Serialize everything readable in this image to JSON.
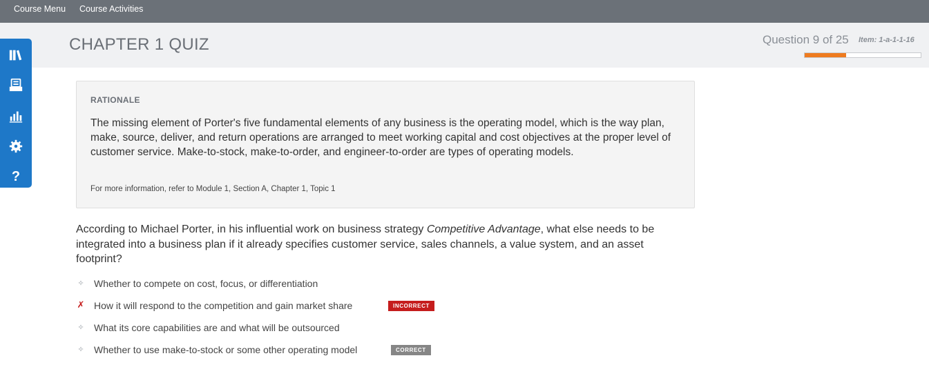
{
  "nav": {
    "course_menu": "Course Menu",
    "course_activities": "Course Activities"
  },
  "header": {
    "title": "CHAPTER 1 QUIZ",
    "question_counter": "Question 9 of 25",
    "item_id": "Item: 1-a-1-1-16",
    "progress_fraction": 0.36,
    "progress_color": "#ee7b1f"
  },
  "sidebar": {
    "icons": [
      "library-icon",
      "course-book-icon",
      "bar-chart-icon",
      "settings-gear-icon",
      "help-icon"
    ],
    "help_glyph": "?",
    "color": "#1e78c8"
  },
  "rationale": {
    "heading": "RATIONALE",
    "body": "The missing element of Porter's five fundamental elements of any business is the operating model, which is the way plan, make, source, deliver, and return operations are arranged to meet working capital and cost objectives at the proper level of customer service. Make-to-stock, make-to-order, and engineer-to-order are types of operating models.",
    "reference": "For more information, refer to Module 1, Section A, Chapter 1, Topic 1"
  },
  "question": {
    "before": "According to Michael Porter, in his influential work on business strategy ",
    "italic": "Competitive Advantage",
    "after": ", what else needs to be integrated into a business plan if it already specifies customer service, sales channels, a value system, and an asset footprint?"
  },
  "answers": [
    {
      "text": "Whether to compete on cost, focus, or differentiation",
      "marker": "✧",
      "badge": ""
    },
    {
      "text": "How it will respond to the competition and gain market share",
      "marker": "✗",
      "badge": "INCORRECT"
    },
    {
      "text": "What its core capabilities are and what will be outsourced",
      "marker": "✧",
      "badge": ""
    },
    {
      "text": "Whether to use make-to-stock or some other operating model",
      "marker": "✧",
      "badge": "CORRECT"
    }
  ],
  "colors": {
    "incorrect": "#c51d1d",
    "correct_badge": "#868686"
  }
}
